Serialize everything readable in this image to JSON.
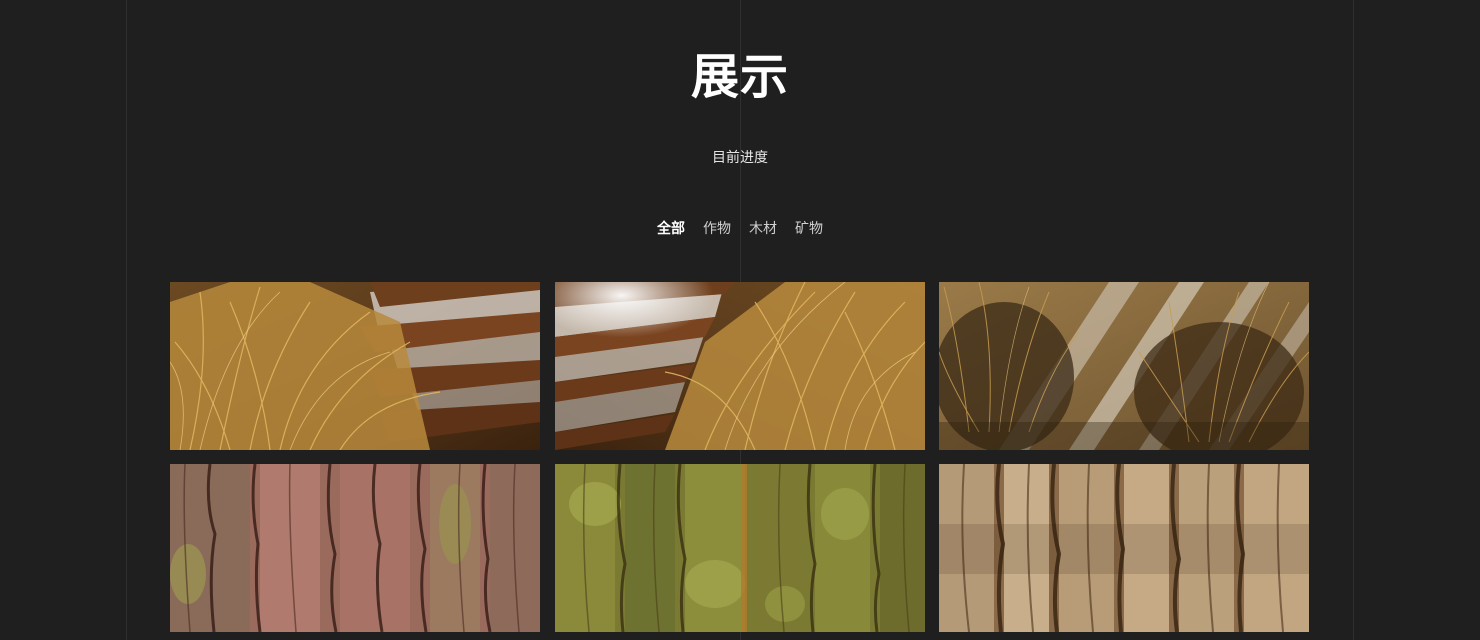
{
  "header": {
    "title": "展示",
    "subtitle": "目前进度"
  },
  "filters": [
    {
      "label": "全部",
      "active": true
    },
    {
      "label": "作物",
      "active": false
    },
    {
      "label": "木材",
      "active": false
    },
    {
      "label": "矿物",
      "active": false
    }
  ],
  "gallery": {
    "items": [
      {
        "name": "dry-grass-wet-logs-1"
      },
      {
        "name": "dry-grass-wet-logs-2"
      },
      {
        "name": "dry-grass-tufts-sand"
      },
      {
        "name": "pine-bark-red"
      },
      {
        "name": "mossy-bark-green"
      },
      {
        "name": "light-brown-bark"
      }
    ]
  },
  "colors": {
    "background": "#1f1f1f",
    "title": "#ffffff",
    "filter_inactive": "#d0d0d0"
  }
}
